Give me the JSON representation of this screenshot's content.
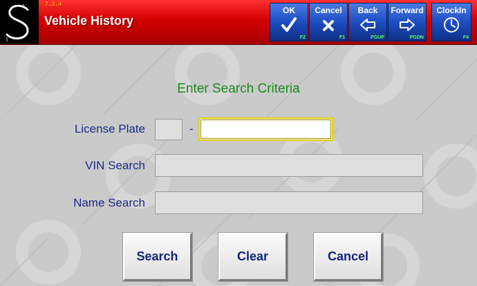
{
  "header": {
    "version": "7.2.4",
    "title": "Vehicle History",
    "buttons": [
      {
        "label": "OK",
        "key": "F2",
        "icon": "check-icon"
      },
      {
        "label": "Cancel",
        "key": "F1",
        "icon": "x-icon"
      },
      {
        "label": "Back",
        "key": "PGUP",
        "icon": "left-arrow-icon"
      },
      {
        "label": "Forward",
        "key": "PGDN",
        "icon": "right-arrow-icon"
      },
      {
        "label": "ClockIn",
        "key": "F4",
        "icon": "clock-icon"
      }
    ]
  },
  "form": {
    "heading": "Enter Search Criteria",
    "license_plate_label": "License Plate",
    "plate_separator": "-",
    "license_plate_state": "",
    "license_plate_value": "",
    "vin_label": "VIN Search",
    "vin_value": "",
    "name_label": "Name Search",
    "name_value": ""
  },
  "actions": {
    "search": "Search",
    "clear": "Clear",
    "cancel": "Cancel"
  },
  "colors": {
    "header_red": "#d40000",
    "toolbar_blue": "#1d4ec2",
    "heading_green": "#1a8a1a",
    "label_navy": "#1a2a8a",
    "hotkey_green": "#5dff5d",
    "focus_yellow": "#e5d000"
  }
}
